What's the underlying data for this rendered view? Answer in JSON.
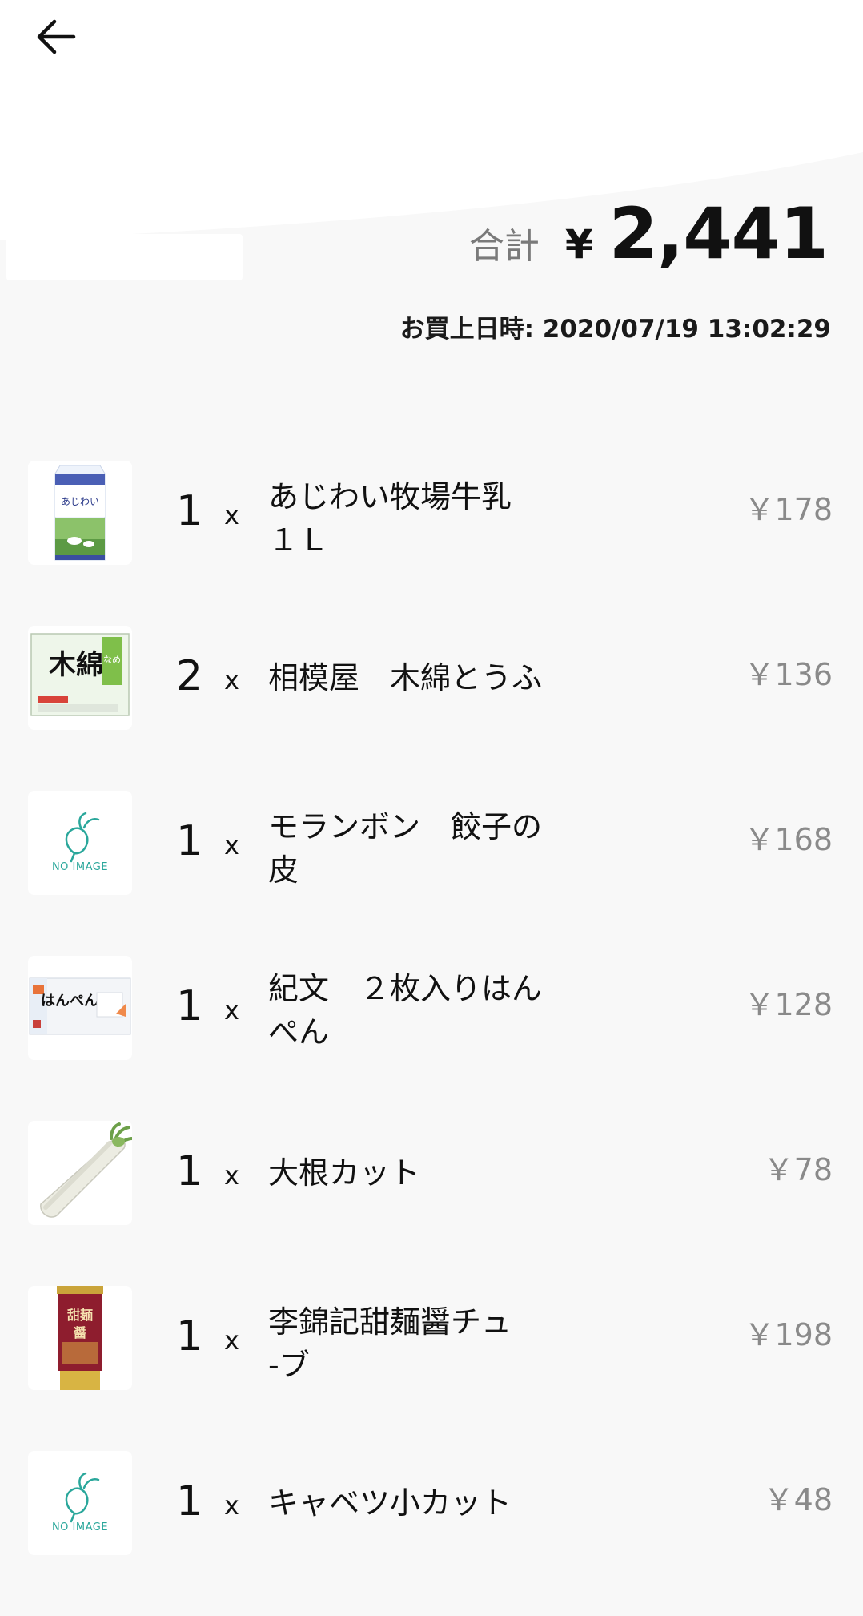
{
  "header": {
    "back_icon": "arrow-left-icon",
    "total_label": "合計",
    "currency_symbol": "¥",
    "total_amount": "2,441",
    "purchase_datetime": "お買上日時: 2020/07/19 13:02:29"
  },
  "items": [
    {
      "quantity": "1",
      "times": "x",
      "name": "あじわい牧場牛乳\n１Ｌ",
      "price": "￥178",
      "thumbnail": "milk-carton-image"
    },
    {
      "quantity": "2",
      "times": "x",
      "name": "相模屋　木綿とうふ",
      "price": "￥136",
      "thumbnail": "tofu-package-image"
    },
    {
      "quantity": "1",
      "times": "x",
      "name": "モランボン　餃子の\n皮",
      "price": "￥168",
      "thumbnail": "no-image-placeholder",
      "no_image_text": "NO IMAGE"
    },
    {
      "quantity": "1",
      "times": "x",
      "name": "紀文　２枚入りはん\nぺん",
      "price": "￥128",
      "thumbnail": "hanpen-package-image"
    },
    {
      "quantity": "1",
      "times": "x",
      "name": "大根カット",
      "price": "￥78",
      "thumbnail": "daikon-radish-image"
    },
    {
      "quantity": "1",
      "times": "x",
      "name": "李錦記甜麺醤チュ\n-ブ",
      "price": "￥198",
      "thumbnail": "sauce-tube-image"
    },
    {
      "quantity": "1",
      "times": "x",
      "name": "キャベツ小カット",
      "price": "￥48",
      "thumbnail": "no-image-placeholder",
      "no_image_text": "NO IMAGE"
    }
  ],
  "colors": {
    "background": "#f8f8f8",
    "total_label": "#7a7a7a",
    "price_text": "#8a8a8a",
    "no_image_teal": "#2aa79b"
  }
}
